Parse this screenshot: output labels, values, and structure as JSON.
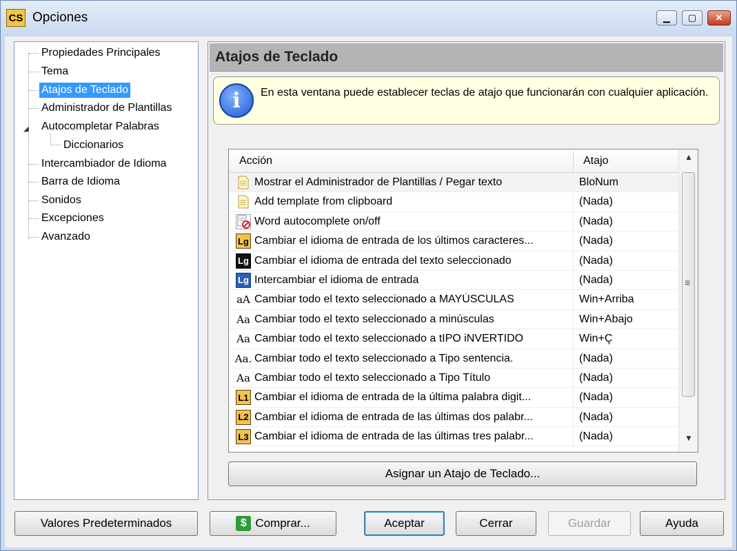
{
  "window": {
    "title": "Opciones",
    "app_icon": "CS",
    "controls": {
      "minimize": "minimize-icon",
      "maximize": "maximize-icon",
      "close": "close-icon"
    }
  },
  "tree": {
    "items": [
      {
        "label": "Propiedades Principales",
        "level": 0
      },
      {
        "label": "Tema",
        "level": 0
      },
      {
        "label": "Atajos de Teclado",
        "level": 0,
        "selected": true
      },
      {
        "label": "Administrador de Plantillas",
        "level": 0
      },
      {
        "label": "Autocompletar Palabras",
        "level": 0,
        "expanded": true
      },
      {
        "label": "Diccionarios",
        "level": 1
      },
      {
        "label": "Intercambiador de Idioma",
        "level": 0
      },
      {
        "label": "Barra de Idioma",
        "level": 0
      },
      {
        "label": "Sonidos",
        "level": 0
      },
      {
        "label": "Excepciones",
        "level": 0
      },
      {
        "label": "Avanzado",
        "level": 0
      }
    ]
  },
  "panel": {
    "title": "Atajos de Teclado",
    "info_icon": "info-icon",
    "info_text": "En esta ventana puede establecer teclas de atajo que funcionarán con cualquier aplicación."
  },
  "list": {
    "columns": [
      "Acción",
      "Atajo"
    ],
    "rows": [
      {
        "icon": "document-icon",
        "glyph": "",
        "action": "Mostrar el Administrador de Plantillas / Pegar texto",
        "shortcut": "BloNum"
      },
      {
        "icon": "clipboard-template-icon",
        "glyph": "",
        "action": "Add template from clipboard",
        "shortcut": "(Nada)"
      },
      {
        "icon": "no-autocomplete-icon",
        "glyph": "",
        "action": "Word autocomplete on/off",
        "shortcut": "(Nada)"
      },
      {
        "icon": "lg-gold-icon",
        "glyph": "Lg",
        "action": "Cambiar el idioma de entrada de los últimos caracteres...",
        "shortcut": "(Nada)"
      },
      {
        "icon": "lg-black-icon",
        "glyph": "Lg",
        "action": "Cambiar el idioma de entrada del texto seleccionado",
        "shortcut": "(Nada)"
      },
      {
        "icon": "lg-blue-icon",
        "glyph": "Lg",
        "action": "Intercambiar el idioma de entrada",
        "shortcut": "(Nada)"
      },
      {
        "icon": "case-upper-icon",
        "glyph": "aA",
        "action": "Cambiar todo el texto seleccionado a MAYÚSCULAS",
        "shortcut": "Win+Arriba"
      },
      {
        "icon": "case-lower-icon",
        "glyph": "Aa",
        "action": "Cambiar todo el texto seleccionado a minúsculas",
        "shortcut": "Win+Abajo"
      },
      {
        "icon": "case-invert-icon",
        "glyph": "Aa",
        "action": "Cambiar todo el texto seleccionado a tIPO iNVERTIDO",
        "shortcut": "Win+Ç"
      },
      {
        "icon": "case-sentence-icon",
        "glyph": "Aa.",
        "action": "Cambiar todo el texto seleccionado a Tipo sentencia.",
        "shortcut": "(Nada)"
      },
      {
        "icon": "case-title-icon",
        "glyph": "Aa",
        "action": "Cambiar todo el texto seleccionado a Tipo Título",
        "shortcut": "(Nada)"
      },
      {
        "icon": "l1-icon",
        "glyph": "L1",
        "action": "Cambiar el idioma de entrada de la última palabra digit...",
        "shortcut": "(Nada)"
      },
      {
        "icon": "l2-icon",
        "glyph": "L2",
        "action": "Cambiar el idioma de entrada de las últimas dos palabr...",
        "shortcut": "(Nada)"
      },
      {
        "icon": "l3-icon",
        "glyph": "L3",
        "action": "Cambiar el idioma de entrada de las últimas tres palabr...",
        "shortcut": "(Nada)"
      }
    ]
  },
  "buttons": {
    "assign": "Asignar un Atajo de Teclado...",
    "defaults": "Valores Predeterminados",
    "buy": "Comprar...",
    "accept": "Aceptar",
    "close": "Cerrar",
    "save": "Guardar",
    "help": "Ayuda"
  },
  "colors": {
    "selection": "#3399ff",
    "info_background": "#ffffe1",
    "panel_header": "#b4b4b4",
    "frame": "#c9d9ef"
  }
}
